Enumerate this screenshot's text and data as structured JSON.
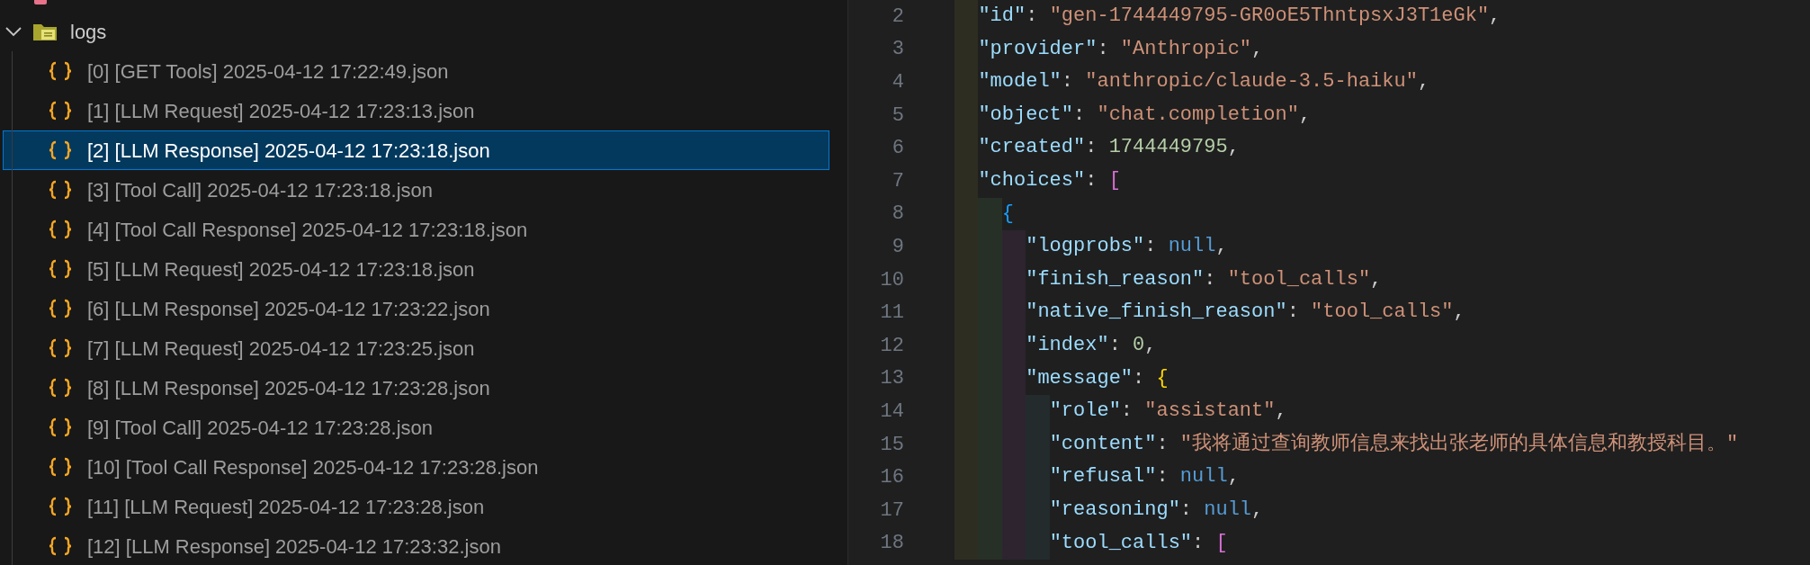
{
  "explorer": {
    "folder": {
      "name": "logs",
      "expanded": true,
      "children": [
        {
          "name": "[0] [GET Tools] 2025-04-12 17:22:49.json",
          "selected": false
        },
        {
          "name": "[1] [LLM Request] 2025-04-12 17:23:13.json",
          "selected": false
        },
        {
          "name": "[2] [LLM Response] 2025-04-12 17:23:18.json",
          "selected": true
        },
        {
          "name": "[3] [Tool Call] 2025-04-12 17:23:18.json",
          "selected": false
        },
        {
          "name": "[4] [Tool Call Response] 2025-04-12 17:23:18.json",
          "selected": false
        },
        {
          "name": "[5] [LLM Request] 2025-04-12 17:23:18.json",
          "selected": false
        },
        {
          "name": "[6] [LLM Response] 2025-04-12 17:23:22.json",
          "selected": false
        },
        {
          "name": "[7] [LLM Request] 2025-04-12 17:23:25.json",
          "selected": false
        },
        {
          "name": "[8] [LLM Response] 2025-04-12 17:23:28.json",
          "selected": false
        },
        {
          "name": "[9] [Tool Call] 2025-04-12 17:23:28.json",
          "selected": false
        },
        {
          "name": "[10] [Tool Call Response] 2025-04-12 17:23:28.json",
          "selected": false
        },
        {
          "name": "[11] [LLM Request] 2025-04-12 17:23:28.json",
          "selected": false
        },
        {
          "name": "[12] [LLM Response] 2025-04-12 17:23:32.json",
          "selected": false
        }
      ]
    }
  },
  "editor": {
    "lines": [
      {
        "number": "2",
        "text": "  \"id\": \"gen-1744449795-GR0oE5ThntpsxJ3T1eGk\","
      },
      {
        "number": "3",
        "text": "  \"provider\": \"Anthropic\","
      },
      {
        "number": "4",
        "text": "  \"model\": \"anthropic/claude-3.5-haiku\","
      },
      {
        "number": "5",
        "text": "  \"object\": \"chat.completion\","
      },
      {
        "number": "6",
        "text": "  \"created\": 1744449795,"
      },
      {
        "number": "7",
        "text": "  \"choices\": ["
      },
      {
        "number": "8",
        "text": "    {"
      },
      {
        "number": "9",
        "text": "      \"logprobs\": null,"
      },
      {
        "number": "10",
        "text": "      \"finish_reason\": \"tool_calls\","
      },
      {
        "number": "11",
        "text": "      \"native_finish_reason\": \"tool_calls\","
      },
      {
        "number": "12",
        "text": "      \"index\": 0,"
      },
      {
        "number": "13",
        "text": "      \"message\": {"
      },
      {
        "number": "14",
        "text": "        \"role\": \"assistant\","
      },
      {
        "number": "15",
        "text": "        \"content\": \"我将通过查询教师信息来找出张老师的具体信息和教授科目。\""
      },
      {
        "number": "16",
        "text": "        \"refusal\": null,"
      },
      {
        "number": "17",
        "text": "        \"reasoning\": null,"
      },
      {
        "number": "18",
        "text": "        \"tool_calls\": ["
      }
    ]
  }
}
